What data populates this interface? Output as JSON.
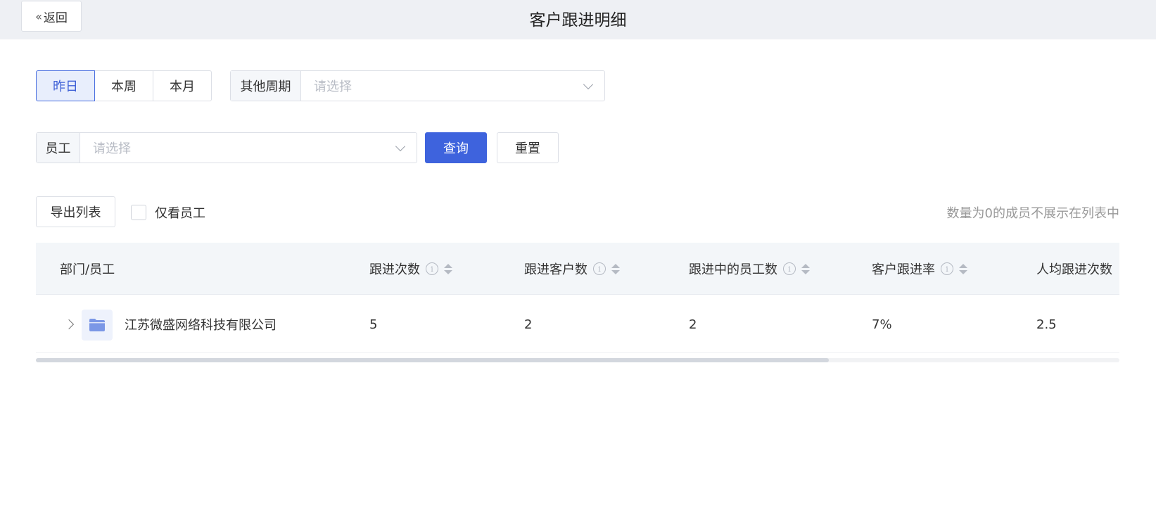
{
  "header": {
    "back_label": "返回",
    "title": "客户跟进明细"
  },
  "filters": {
    "periods": [
      {
        "label": "昨日",
        "active": true
      },
      {
        "label": "本周",
        "active": false
      },
      {
        "label": "本月",
        "active": false
      }
    ],
    "other_period": {
      "label": "其他周期",
      "placeholder": "请选择"
    },
    "employee": {
      "label": "员工",
      "placeholder": "请选择"
    },
    "query_label": "查询",
    "reset_label": "重置"
  },
  "toolbar": {
    "export_label": "导出列表",
    "only_employee_label": "仅看员工",
    "hint": "数量为0的成员不展示在列表中"
  },
  "table": {
    "columns": [
      "部门/员工",
      "跟进次数",
      "跟进客户数",
      "跟进中的员工数",
      "客户跟进率",
      "人均跟进次数"
    ],
    "rows": [
      {
        "name": "江苏微盛网络科技有限公司",
        "follow_count": "5",
        "customer_count": "2",
        "employee_count": "2",
        "rate": "7%",
        "avg": "2.5"
      }
    ]
  },
  "colors": {
    "primary": "#3e63dd",
    "header_bg": "#eef0f4",
    "table_head_bg": "#f3f6f9",
    "folder": "#7b97e6"
  }
}
